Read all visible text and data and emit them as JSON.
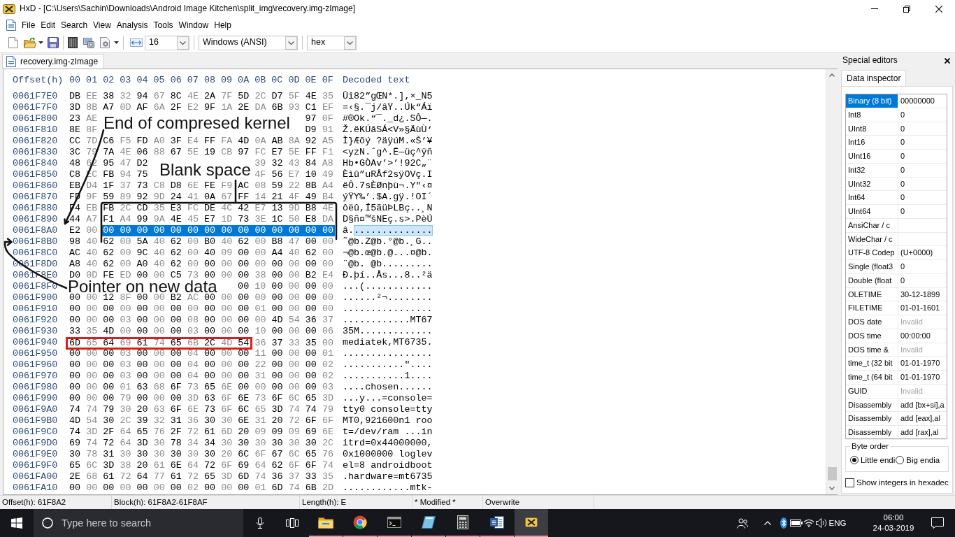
{
  "window": {
    "title": "HxD - [C:\\Users\\Sachin\\Downloads\\Android Image Kitchen\\split_img\\recovery.img-zImage]"
  },
  "menu": [
    "File",
    "Edit",
    "Search",
    "View",
    "Analysis",
    "Tools",
    "Window",
    "Help"
  ],
  "toolbar": {
    "bytes_per_row": "16",
    "encoding": "Windows (ANSI)",
    "offset_base": "hex"
  },
  "tabs": [
    {
      "label": "recovery.img-zImage",
      "selected": true
    }
  ],
  "hex_view": {
    "header": {
      "offset": "Offset(h)",
      "columns": [
        "00",
        "01",
        "02",
        "03",
        "04",
        "05",
        "06",
        "07",
        "08",
        "09",
        "0A",
        "0B",
        "0C",
        "0D",
        "0E",
        "0F"
      ],
      "decoded": "Decoded text"
    },
    "rows": [
      {
        "offset": "0061F7E0",
        "bytes": [
          {
            "kind": "plain",
            "values": [
              "DB",
              "EE",
              "38",
              "32",
              "94",
              "67",
              "8C",
              "4E",
              "2A",
              "7F",
              "5D",
              "2C",
              "D7",
              "5F",
              "4E",
              "35"
            ],
            "selected": false
          }
        ],
        "decoded": [
          {
            "text": "Ûî82”gŒN*.],×_N5",
            "selected": false
          }
        ]
      },
      {
        "offset": "0061F7F0",
        "bytes": [
          {
            "kind": "plain",
            "values": [
              "3D",
              "8B",
              "A7",
              "0D",
              "AF",
              "6A",
              "2F",
              "E2",
              "9F",
              "1A",
              "2E",
              "DA",
              "6B",
              "93",
              "C1",
              "EF"
            ],
            "selected": false
          }
        ],
        "decoded": [
          {
            "text": "=‹§.¯j/âŸ..Úk“Áï",
            "selected": false
          }
        ]
      },
      {
        "offset": "0061F800",
        "bytes": [
          {
            "kind": "plain",
            "values": [
              "23",
              "AE"
            ],
            "selected": false
          },
          {
            "kind": "covered"
          },
          {
            "kind": "plain",
            "values": [
              "97",
              "0F"
            ],
            "selected": false
          }
        ],
        "decoded": [
          {
            "text": "#®Ok.“¯._d¿.SÔ—.",
            "selected": false
          }
        ]
      },
      {
        "offset": "0061F810",
        "bytes": [
          {
            "kind": "plain",
            "values": [
              "8E",
              "8F"
            ],
            "selected": false
          },
          {
            "kind": "covered"
          },
          {
            "kind": "plain",
            "values": [
              "D9",
              "91"
            ],
            "selected": false
          }
        ],
        "decoded": [
          {
            "text": "Ž.ëKÚãSÁ<V»§ÄùÙ‘",
            "selected": false
          }
        ]
      },
      {
        "offset": "0061F820",
        "bytes": [
          {
            "kind": "plain",
            "values": [
              "CC",
              "7D",
              "C6",
              "F5",
              "FD",
              "A0",
              "3F",
              "E4",
              "FF",
              "FA",
              "4D",
              "0A",
              "AB",
              "8A",
              "92",
              "A5"
            ],
            "selected": false
          }
        ],
        "decoded": [
          {
            "text": "Ì}Æõý ?äÿúM.«Š’¥",
            "selected": false
          }
        ]
      },
      {
        "offset": "0061F830",
        "bytes": [
          {
            "kind": "plain",
            "values": [
              "3C",
              "79",
              "7A",
              "4E",
              "06",
              "88",
              "67",
              "5E",
              "19",
              "CB",
              "97",
              "FC",
              "E7",
              "5E",
              "FF",
              "F1"
            ],
            "selected": false
          }
        ],
        "decoded": [
          {
            "text": "<yzN.ˆg^.Ë—üç^ÿñ",
            "selected": false
          }
        ]
      },
      {
        "offset": "0061F840",
        "bytes": [
          {
            "kind": "plain",
            "values": [
              "48",
              "62",
              "95",
              "47",
              "D2"
            ],
            "selected": false
          },
          {
            "kind": "covered"
          },
          {
            "kind": "plain",
            "values": [
              "39",
              "32",
              "43",
              "84",
              "A8"
            ],
            "selected": false
          }
        ],
        "decoded": [
          {
            "text": "Hb•GÒAv’>’!92C„¨",
            "selected": false
          }
        ]
      },
      {
        "offset": "0061F850",
        "bytes": [
          {
            "kind": "plain",
            "values": [
              "C8",
              "EC",
              "FB",
              "94",
              "75"
            ],
            "selected": false
          },
          {
            "kind": "covered"
          },
          {
            "kind": "plain",
            "values": [
              "4F",
              "56",
              "E7",
              "10",
              "49"
            ],
            "selected": false
          }
        ],
        "decoded": [
          {
            "text": "Èìû”uRÅf2sÿOVç.I",
            "selected": false
          }
        ]
      },
      {
        "offset": "0061F860",
        "bytes": [
          {
            "kind": "plain",
            "values": [
              "EB",
              "D4",
              "1F",
              "37",
              "73",
              "C8",
              "D8",
              "6E",
              "FE",
              "F9",
              "AC",
              "08",
              "59",
              "22",
              "8B",
              "A4"
            ],
            "selected": false
          }
        ],
        "decoded": [
          {
            "text": "ëÔ.7sÈØnþù¬.Y\"‹¤",
            "selected": false
          }
        ]
      },
      {
        "offset": "0061F870",
        "bytes": [
          {
            "kind": "plain",
            "values": [
              "FD",
              "9F",
              "59",
              "89",
              "92",
              "9D",
              "24",
              "41",
              "0A",
              "67",
              "FF",
              "14",
              "21",
              "4F",
              "49",
              "B4"
            ],
            "selected": false
          }
        ],
        "decoded": [
          {
            "text": "ýŸY‰’.$A.gÿ.!OI´",
            "selected": false
          }
        ]
      },
      {
        "offset": "0061F880",
        "bytes": [
          {
            "kind": "plain",
            "values": [
              "F4",
              "EB",
              "FB",
              "2C",
              "CD",
              "35",
              "E3",
              "FC",
              "DE",
              "4C",
              "42",
              "E7",
              "13",
              "9D",
              "B8",
              "4E"
            ],
            "selected": false
          }
        ],
        "decoded": [
          {
            "text": "ôëû,Í5ãüÞLBç..¸N",
            "selected": false
          }
        ]
      },
      {
        "offset": "0061F890",
        "bytes": [
          {
            "kind": "plain",
            "values": [
              "44",
              "A7",
              "F1",
              "A4",
              "99",
              "9A",
              "4E",
              "45",
              "E7",
              "1D",
              "73",
              "3E",
              "1C",
              "50",
              "E8",
              "DA"
            ],
            "selected": false
          }
        ],
        "decoded": [
          {
            "text": "D§ñ¤™šNEç.s>.PèÚ",
            "selected": false
          }
        ]
      },
      {
        "offset": "0061F8A0",
        "bytes": [
          {
            "kind": "plain",
            "values": [
              "E2",
              "00"
            ],
            "selected": false
          },
          {
            "kind": "plain",
            "values": [
              "00",
              "00",
              "00",
              "00",
              "00",
              "00",
              "00",
              "00",
              "00",
              "00",
              "00",
              "00",
              "00",
              "00"
            ],
            "selected": true
          }
        ],
        "decoded": [
          {
            "text": "â.",
            "selected": false
          },
          {
            "text": "..............",
            "selected": true
          }
        ]
      },
      {
        "offset": "0061F8B0",
        "bytes": [
          {
            "kind": "plain",
            "values": [
              "98",
              "40",
              "62",
              "00",
              "5A",
              "40",
              "62",
              "00",
              "B0",
              "40",
              "62",
              "00",
              "B8",
              "47",
              "00",
              "00"
            ],
            "selected": false
          }
        ],
        "decoded": [
          {
            "text": "˜@b.Z@b.°@b.¸G..",
            "selected": false
          }
        ]
      },
      {
        "offset": "0061F8C0",
        "bytes": [
          {
            "kind": "plain",
            "values": [
              "AC",
              "40",
              "62",
              "00",
              "9C",
              "40",
              "62",
              "00",
              "40",
              "09",
              "00",
              "00",
              "A4",
              "40",
              "62",
              "00"
            ],
            "selected": false
          }
        ],
        "decoded": [
          {
            "text": "¬@b.œ@b.@...¤@b.",
            "selected": false
          }
        ]
      },
      {
        "offset": "0061F8D0",
        "bytes": [
          {
            "kind": "plain",
            "values": [
              "A8",
              "40",
              "62",
              "00",
              "A0",
              "40",
              "62",
              "00",
              "00",
              "00",
              "00",
              "00",
              "00",
              "00",
              "00",
              "00"
            ],
            "selected": false
          }
        ],
        "decoded": [
          {
            "text": "¨@b. @b.........",
            "selected": false
          }
        ]
      },
      {
        "offset": "0061F8E0",
        "bytes": [
          {
            "kind": "plain",
            "values": [
              "D0",
              "0D",
              "FE",
              "ED",
              "00",
              "00",
              "C5",
              "73",
              "00",
              "00",
              "00",
              "38",
              "00",
              "00",
              "B2",
              "E4"
            ],
            "selected": false
          }
        ],
        "decoded": [
          {
            "text": "Ð.þí..Ås...8..²ä",
            "selected": false
          }
        ]
      },
      {
        "offset": "0061F8F0",
        "bytes": [
          {
            "kind": "covered"
          },
          {
            "kind": "plain",
            "values": [
              "00",
              "10",
              "00",
              "00",
              "00",
              "00"
            ],
            "selected": false
          }
        ],
        "decoded": [
          {
            "text": "...(............",
            "selected": false
          }
        ]
      },
      {
        "offset": "0061F900",
        "bytes": [
          {
            "kind": "plain",
            "values": [
              "00",
              "00",
              "12",
              "8F",
              "00",
              "00",
              "B2",
              "AC",
              "00",
              "00",
              "00",
              "00",
              "00",
              "00",
              "00",
              "00"
            ],
            "selected": false
          }
        ],
        "decoded": [
          {
            "text": "......²¬........",
            "selected": false
          }
        ]
      },
      {
        "offset": "0061F910",
        "bytes": [
          {
            "kind": "plain",
            "values": [
              "00",
              "00",
              "00",
              "00",
              "00",
              "00",
              "00",
              "00",
              "00",
              "00",
              "00",
              "01",
              "00",
              "00",
              "00",
              "00"
            ],
            "selected": false
          }
        ],
        "decoded": [
          {
            "text": "................",
            "selected": false
          }
        ]
      },
      {
        "offset": "0061F920",
        "bytes": [
          {
            "kind": "plain",
            "values": [
              "00",
              "00",
              "00",
              "03",
              "00",
              "00",
              "00",
              "08",
              "00",
              "00",
              "00",
              "00",
              "4D",
              "54",
              "36",
              "37"
            ],
            "selected": false
          }
        ],
        "decoded": [
          {
            "text": "............MT67",
            "selected": false
          }
        ]
      },
      {
        "offset": "0061F930",
        "bytes": [
          {
            "kind": "plain",
            "values": [
              "33",
              "35",
              "4D",
              "00",
              "00",
              "00",
              "00",
              "03",
              "00",
              "00",
              "00",
              "10",
              "00",
              "00",
              "00",
              "06"
            ],
            "selected": false
          }
        ],
        "decoded": [
          {
            "text": "35M.............",
            "selected": false
          }
        ]
      },
      {
        "offset": "0061F940",
        "bytes": [
          {
            "kind": "outlined",
            "values": [
              "6D",
              "65",
              "64",
              "69",
              "61",
              "74",
              "65",
              "6B",
              "2C",
              "4D",
              "54"
            ],
            "selected": false
          },
          {
            "kind": "plain",
            "values": [
              "36",
              "37",
              "33",
              "35",
              "00"
            ],
            "selected": false
          }
        ],
        "decoded": [
          {
            "text": "mediatek,MT6735.",
            "selected": false
          }
        ]
      },
      {
        "offset": "0061F950",
        "bytes": [
          {
            "kind": "plain",
            "values": [
              "00",
              "00",
              "00",
              "03",
              "00",
              "00",
              "00",
              "04",
              "00",
              "00",
              "00",
              "11",
              "00",
              "00",
              "00",
              "01"
            ],
            "selected": false
          }
        ],
        "decoded": [
          {
            "text": "................",
            "selected": false
          }
        ]
      },
      {
        "offset": "0061F960",
        "bytes": [
          {
            "kind": "plain",
            "values": [
              "00",
              "00",
              "00",
              "03",
              "00",
              "00",
              "00",
              "04",
              "00",
              "00",
              "00",
              "22",
              "00",
              "00",
              "00",
              "02"
            ],
            "selected": false
          }
        ],
        "decoded": [
          {
            "text": "...........\"....",
            "selected": false
          }
        ]
      },
      {
        "offset": "0061F970",
        "bytes": [
          {
            "kind": "plain",
            "values": [
              "00",
              "00",
              "00",
              "03",
              "00",
              "00",
              "00",
              "04",
              "00",
              "00",
              "00",
              "31",
              "00",
              "00",
              "00",
              "02"
            ],
            "selected": false
          }
        ],
        "decoded": [
          {
            "text": "...........1....",
            "selected": false
          }
        ]
      },
      {
        "offset": "0061F980",
        "bytes": [
          {
            "kind": "plain",
            "values": [
              "00",
              "00",
              "00",
              "01",
              "63",
              "68",
              "6F",
              "73",
              "65",
              "6E",
              "00",
              "00",
              "00",
              "00",
              "00",
              "03"
            ],
            "selected": false
          }
        ],
        "decoded": [
          {
            "text": "....chosen......",
            "selected": false
          }
        ]
      },
      {
        "offset": "0061F990",
        "bytes": [
          {
            "kind": "plain",
            "values": [
              "00",
              "00",
              "00",
              "79",
              "00",
              "00",
              "00",
              "3D",
              "63",
              "6F",
              "6E",
              "73",
              "6F",
              "6C",
              "65",
              "3D"
            ],
            "selected": false
          }
        ],
        "decoded": [
          {
            "text": "...y...=console=",
            "selected": false
          }
        ]
      },
      {
        "offset": "0061F9A0",
        "bytes": [
          {
            "kind": "plain",
            "values": [
              "74",
              "74",
              "79",
              "30",
              "20",
              "63",
              "6F",
              "6E",
              "73",
              "6F",
              "6C",
              "65",
              "3D",
              "74",
              "74",
              "79"
            ],
            "selected": false
          }
        ],
        "decoded": [
          {
            "text": "tty0 console=tty",
            "selected": false
          }
        ]
      },
      {
        "offset": "0061F9B0",
        "bytes": [
          {
            "kind": "plain",
            "values": [
              "4D",
              "54",
              "30",
              "2C",
              "39",
              "32",
              "31",
              "36",
              "30",
              "30",
              "6E",
              "31",
              "20",
              "72",
              "6F",
              "6F"
            ],
            "selected": false
          }
        ],
        "decoded": [
          {
            "text": "MT0,921600n1 roo",
            "selected": false
          }
        ]
      },
      {
        "offset": "0061F9C0",
        "bytes": [
          {
            "kind": "plain",
            "values": [
              "74",
              "3D",
              "2F",
              "64",
              "65",
              "76",
              "2F",
              "72",
              "61",
              "6D",
              "20",
              "09",
              "09",
              "09",
              "69",
              "6E"
            ],
            "selected": false
          }
        ],
        "decoded": [
          {
            "text": "t=/dev/ram ...in",
            "selected": false
          }
        ]
      },
      {
        "offset": "0061F9D0",
        "bytes": [
          {
            "kind": "plain",
            "values": [
              "69",
              "74",
              "72",
              "64",
              "3D",
              "30",
              "78",
              "34",
              "34",
              "30",
              "30",
              "30",
              "30",
              "30",
              "30",
              "2C"
            ],
            "selected": false
          }
        ],
        "decoded": [
          {
            "text": "itrd=0x44000000,",
            "selected": false
          }
        ]
      },
      {
        "offset": "0061F9E0",
        "bytes": [
          {
            "kind": "plain",
            "values": [
              "30",
              "78",
              "31",
              "30",
              "30",
              "30",
              "30",
              "30",
              "30",
              "20",
              "6C",
              "6F",
              "67",
              "6C",
              "65",
              "76"
            ],
            "selected": false
          }
        ],
        "decoded": [
          {
            "text": "0x1000000 loglev",
            "selected": false
          }
        ]
      },
      {
        "offset": "0061F9F0",
        "bytes": [
          {
            "kind": "plain",
            "values": [
              "65",
              "6C",
              "3D",
              "38",
              "20",
              "61",
              "6E",
              "64",
              "72",
              "6F",
              "69",
              "64",
              "62",
              "6F",
              "6F",
              "74"
            ],
            "selected": false
          }
        ],
        "decoded": [
          {
            "text": "el=8 androidboot",
            "selected": false
          }
        ]
      },
      {
        "offset": "0061FA00",
        "bytes": [
          {
            "kind": "plain",
            "values": [
              "2E",
              "68",
              "61",
              "72",
              "64",
              "77",
              "61",
              "72",
              "65",
              "3D",
              "6D",
              "74",
              "36",
              "37",
              "33",
              "35"
            ],
            "selected": false
          }
        ],
        "decoded": [
          {
            "text": ".hardware=mt6735",
            "selected": false
          }
        ]
      },
      {
        "offset": "0061FA10",
        "bytes": [
          {
            "kind": "plain",
            "values": [
              "00",
              "00",
              "00",
              "00",
              "00",
              "00",
              "00",
              "02",
              "00",
              "00",
              "00",
              "01",
              "6D",
              "74",
              "6B",
              "2D"
            ],
            "selected": false
          }
        ],
        "decoded": [
          {
            "text": "............mtk-",
            "selected": false
          }
        ]
      }
    ]
  },
  "annotations": [
    {
      "text": "End of compresed kernel"
    },
    {
      "text": "Blank space"
    },
    {
      "text": "Pointer on new data"
    }
  ],
  "special_editors": {
    "title": "Special editors",
    "tabs": [
      {
        "label": "Data inspector",
        "selected": true
      }
    ],
    "inspector": {
      "fields": [
        {
          "label": "Binary (8 bit)",
          "value": "00000000",
          "selected": true,
          "invalid": false
        },
        {
          "label": "Int8",
          "value": "0",
          "selected": false,
          "invalid": false
        },
        {
          "label": "UInt8",
          "value": "0",
          "selected": false,
          "invalid": false
        },
        {
          "label": "Int16",
          "value": "0",
          "selected": false,
          "invalid": false
        },
        {
          "label": "UInt16",
          "value": "0",
          "selected": false,
          "invalid": false
        },
        {
          "label": "Int32",
          "value": "0",
          "selected": false,
          "invalid": false
        },
        {
          "label": "UInt32",
          "value": "0",
          "selected": false,
          "invalid": false
        },
        {
          "label": "Int64",
          "value": "0",
          "selected": false,
          "invalid": false
        },
        {
          "label": "UInt64",
          "value": "0",
          "selected": false,
          "invalid": false
        },
        {
          "label": "AnsiChar / c",
          "selected": false
        },
        {
          "label": "WideChar / c",
          "selected": false
        },
        {
          "label": "UTF-8 Codep",
          "value": "(U+0000)",
          "selected": false,
          "invalid": false
        },
        {
          "label": "Single (float3",
          "value": "0",
          "selected": false,
          "invalid": false
        },
        {
          "label": "Double (float",
          "value": "0",
          "selected": false,
          "invalid": false
        },
        {
          "label": "OLETIME",
          "value": "30-12-1899",
          "selected": false,
          "invalid": false
        },
        {
          "label": "FILETIME",
          "value": "01-01-1601",
          "selected": false,
          "invalid": false
        },
        {
          "label": "DOS date",
          "value": "Invalid",
          "selected": false,
          "invalid": true
        },
        {
          "label": "DOS time",
          "value": "00:00:00",
          "selected": false,
          "invalid": false
        },
        {
          "label": "DOS time &",
          "value": "Invalid",
          "selected": false,
          "invalid": true
        },
        {
          "label": "time_t (32 bit",
          "value": "01-01-1970",
          "selected": false,
          "invalid": false
        },
        {
          "label": "time_t (64 bit",
          "value": "01-01-1970",
          "selected": false,
          "invalid": false
        },
        {
          "label": "GUID",
          "value": "Invalid",
          "selected": false,
          "invalid": true
        },
        {
          "label": "Disassembly",
          "value": "add [bx+si],a",
          "selected": false,
          "invalid": false
        },
        {
          "label": "Disassembly",
          "value": "add [eax],al",
          "selected": false,
          "invalid": false
        },
        {
          "label": "Disassembly",
          "value": "add [rax],al",
          "selected": false,
          "invalid": false
        }
      ]
    },
    "byte_order": {
      "title": "Byte order",
      "options": [
        {
          "label": "Little endi",
          "selected": true
        },
        {
          "label": "Big endia",
          "selected": false
        }
      ]
    },
    "options": [
      {
        "label": "Show integers in hexadec",
        "checked": false
      }
    ]
  },
  "status_bar": [
    "Offset(h): 61F8A2",
    "Block(h): 61F8A2-61F8AF",
    "Length(h): E",
    "* Modified *",
    "Overwrite"
  ],
  "taskbar": {
    "search": {
      "placeholder": "Type here to search"
    },
    "apps": [
      {
        "kind": "folder",
        "active": false,
        "running": true
      },
      {
        "kind": "browser",
        "active": false,
        "running": true
      },
      {
        "kind": "terminal",
        "active": false,
        "running": true
      },
      {
        "kind": "tile",
        "active": false,
        "running": true
      },
      {
        "kind": "calculator",
        "active": false,
        "running": true
      },
      {
        "kind": "document",
        "active": false,
        "running": true
      },
      {
        "kind": "hexeditor",
        "active": true,
        "running": true
      }
    ],
    "tray": {
      "language": "ENG",
      "time": "06:00",
      "date": "24-03-2019"
    }
  }
}
